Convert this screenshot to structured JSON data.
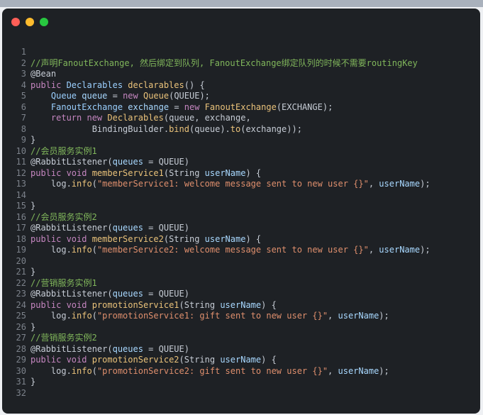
{
  "window": {
    "traffic_lights": [
      {
        "name": "close-button",
        "color": "#ff5f57"
      },
      {
        "name": "minimize-button",
        "color": "#febc2e"
      },
      {
        "name": "maximize-button",
        "color": "#28c840"
      }
    ]
  },
  "code": {
    "lines": [
      {
        "n": "1",
        "tokens": []
      },
      {
        "n": "2",
        "tokens": [
          {
            "t": "//声明FanoutExchange, 然后绑定到队列, FanoutExchange绑定队列的时候不需要routingKey",
            "c": "comment"
          }
        ]
      },
      {
        "n": "3",
        "tokens": [
          {
            "t": "@Bean",
            "c": "ann"
          }
        ]
      },
      {
        "n": "4",
        "tokens": [
          {
            "t": "public ",
            "c": "kw"
          },
          {
            "t": "Declarables ",
            "c": "type"
          },
          {
            "t": "declarables",
            "c": "fn"
          },
          {
            "t": "() {",
            "c": "plain"
          }
        ]
      },
      {
        "n": "5",
        "tokens": [
          {
            "t": "    ",
            "c": "plain"
          },
          {
            "t": "Queue ",
            "c": "type"
          },
          {
            "t": "queue ",
            "c": "var"
          },
          {
            "t": "= ",
            "c": "plain"
          },
          {
            "t": "new ",
            "c": "kw"
          },
          {
            "t": "Queue",
            "c": "fn"
          },
          {
            "t": "(QUEUE);",
            "c": "plain"
          }
        ]
      },
      {
        "n": "6",
        "tokens": [
          {
            "t": "    ",
            "c": "plain"
          },
          {
            "t": "FanoutExchange ",
            "c": "type"
          },
          {
            "t": "exchange ",
            "c": "var"
          },
          {
            "t": "= ",
            "c": "plain"
          },
          {
            "t": "new ",
            "c": "kw"
          },
          {
            "t": "FanoutExchange",
            "c": "fn"
          },
          {
            "t": "(EXCHANGE);",
            "c": "plain"
          }
        ]
      },
      {
        "n": "7",
        "tokens": [
          {
            "t": "    ",
            "c": "plain"
          },
          {
            "t": "return ",
            "c": "kw"
          },
          {
            "t": "new ",
            "c": "kw"
          },
          {
            "t": "Declarables",
            "c": "fn"
          },
          {
            "t": "(queue, exchange,",
            "c": "plain"
          }
        ]
      },
      {
        "n": "8",
        "tokens": [
          {
            "t": "            BindingBuilder.",
            "c": "plain"
          },
          {
            "t": "bind",
            "c": "fn"
          },
          {
            "t": "(queue).",
            "c": "plain"
          },
          {
            "t": "to",
            "c": "fn"
          },
          {
            "t": "(exchange));",
            "c": "plain"
          }
        ]
      },
      {
        "n": "9",
        "tokens": [
          {
            "t": "}",
            "c": "plain"
          }
        ]
      },
      {
        "n": "10",
        "tokens": [
          {
            "t": "//会员服务实例1",
            "c": "comment"
          }
        ]
      },
      {
        "n": "11",
        "tokens": [
          {
            "t": "@RabbitListener(",
            "c": "ann"
          },
          {
            "t": "queues ",
            "c": "var"
          },
          {
            "t": "= QUEUE)",
            "c": "plain"
          }
        ]
      },
      {
        "n": "12",
        "tokens": [
          {
            "t": "public void ",
            "c": "kw"
          },
          {
            "t": "memberService1",
            "c": "fn"
          },
          {
            "t": "(String ",
            "c": "plain"
          },
          {
            "t": "userName",
            "c": "var"
          },
          {
            "t": ") {",
            "c": "plain"
          }
        ]
      },
      {
        "n": "13",
        "tokens": [
          {
            "t": "    log.",
            "c": "plain"
          },
          {
            "t": "info",
            "c": "fn"
          },
          {
            "t": "(",
            "c": "plain"
          },
          {
            "t": "\"memberService1: welcome message sent to new user {}\"",
            "c": "str"
          },
          {
            "t": ", ",
            "c": "plain"
          },
          {
            "t": "userName",
            "c": "var"
          },
          {
            "t": ");",
            "c": "plain"
          }
        ]
      },
      {
        "n": "14",
        "tokens": []
      },
      {
        "n": "15",
        "tokens": [
          {
            "t": "}",
            "c": "plain"
          }
        ]
      },
      {
        "n": "16",
        "tokens": [
          {
            "t": "//会员服务实例2",
            "c": "comment"
          }
        ]
      },
      {
        "n": "17",
        "tokens": [
          {
            "t": "@RabbitListener(",
            "c": "ann"
          },
          {
            "t": "queues ",
            "c": "var"
          },
          {
            "t": "= QUEUE)",
            "c": "plain"
          }
        ]
      },
      {
        "n": "18",
        "tokens": [
          {
            "t": "public void ",
            "c": "kw"
          },
          {
            "t": "memberService2",
            "c": "fn"
          },
          {
            "t": "(String ",
            "c": "plain"
          },
          {
            "t": "userName",
            "c": "var"
          },
          {
            "t": ") {",
            "c": "plain"
          }
        ]
      },
      {
        "n": "19",
        "tokens": [
          {
            "t": "    log.",
            "c": "plain"
          },
          {
            "t": "info",
            "c": "fn"
          },
          {
            "t": "(",
            "c": "plain"
          },
          {
            "t": "\"memberService2: welcome message sent to new user {}\"",
            "c": "str"
          },
          {
            "t": ", ",
            "c": "plain"
          },
          {
            "t": "userName",
            "c": "var"
          },
          {
            "t": ");",
            "c": "plain"
          }
        ]
      },
      {
        "n": "20",
        "tokens": []
      },
      {
        "n": "21",
        "tokens": [
          {
            "t": "}",
            "c": "plain"
          }
        ]
      },
      {
        "n": "22",
        "tokens": [
          {
            "t": "//营销服务实例1",
            "c": "comment"
          }
        ]
      },
      {
        "n": "23",
        "tokens": [
          {
            "t": "@RabbitListener(",
            "c": "ann"
          },
          {
            "t": "queues ",
            "c": "var"
          },
          {
            "t": "= QUEUE)",
            "c": "plain"
          }
        ]
      },
      {
        "n": "24",
        "tokens": [
          {
            "t": "public void ",
            "c": "kw"
          },
          {
            "t": "promotionService1",
            "c": "fn"
          },
          {
            "t": "(String ",
            "c": "plain"
          },
          {
            "t": "userName",
            "c": "var"
          },
          {
            "t": ") {",
            "c": "plain"
          }
        ]
      },
      {
        "n": "25",
        "tokens": [
          {
            "t": "    log.",
            "c": "plain"
          },
          {
            "t": "info",
            "c": "fn"
          },
          {
            "t": "(",
            "c": "plain"
          },
          {
            "t": "\"promotionService1: gift sent to new user {}\"",
            "c": "str"
          },
          {
            "t": ", ",
            "c": "plain"
          },
          {
            "t": "userName",
            "c": "var"
          },
          {
            "t": ");",
            "c": "plain"
          }
        ]
      },
      {
        "n": "26",
        "tokens": [
          {
            "t": "}",
            "c": "plain"
          }
        ]
      },
      {
        "n": "27",
        "tokens": [
          {
            "t": "//营销服务实例2",
            "c": "comment"
          }
        ]
      },
      {
        "n": "28",
        "tokens": [
          {
            "t": "@RabbitListener(",
            "c": "ann"
          },
          {
            "t": "queues ",
            "c": "var"
          },
          {
            "t": "= QUEUE)",
            "c": "plain"
          }
        ]
      },
      {
        "n": "29",
        "tokens": [
          {
            "t": "public void ",
            "c": "kw"
          },
          {
            "t": "promotionService2",
            "c": "fn"
          },
          {
            "t": "(String ",
            "c": "plain"
          },
          {
            "t": "userName",
            "c": "var"
          },
          {
            "t": ") {",
            "c": "plain"
          }
        ]
      },
      {
        "n": "30",
        "tokens": [
          {
            "t": "    log.",
            "c": "plain"
          },
          {
            "t": "info",
            "c": "fn"
          },
          {
            "t": "(",
            "c": "plain"
          },
          {
            "t": "\"promotionService2: gift sent to new user {}\"",
            "c": "str"
          },
          {
            "t": ", ",
            "c": "plain"
          },
          {
            "t": "userName",
            "c": "var"
          },
          {
            "t": ");",
            "c": "plain"
          }
        ]
      },
      {
        "n": "31",
        "tokens": [
          {
            "t": "}",
            "c": "plain"
          }
        ]
      },
      {
        "n": "32",
        "tokens": []
      }
    ]
  }
}
